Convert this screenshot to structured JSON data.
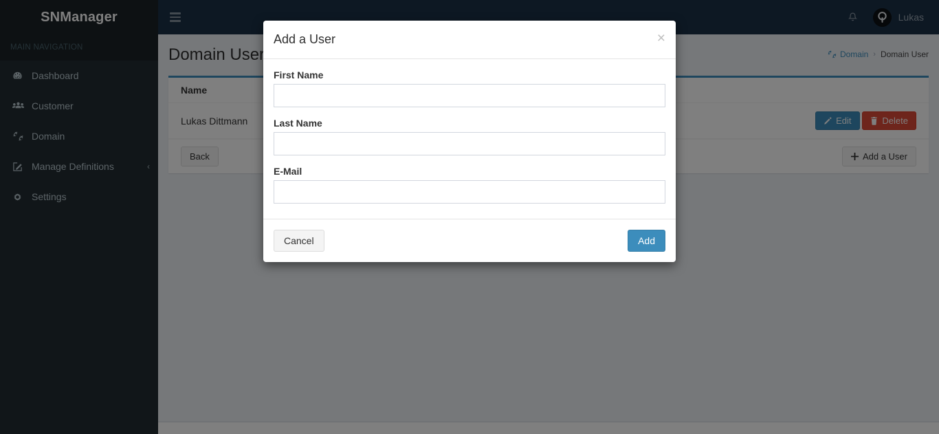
{
  "brand": {
    "title": "SNManager"
  },
  "sidebar": {
    "header": "MAIN NAVIGATION",
    "items": [
      {
        "label": "Dashboard",
        "icon": "dashboard-icon"
      },
      {
        "label": "Customer",
        "icon": "users-icon"
      },
      {
        "label": "Domain",
        "icon": "gears-icon"
      },
      {
        "label": "Manage Definitions",
        "icon": "edit-square-icon",
        "arrow": "‹"
      },
      {
        "label": "Settings",
        "icon": "gear-icon"
      }
    ]
  },
  "navbar": {
    "toggle": "sidebar-toggle-icon",
    "bell": "bell-icon",
    "user_name": "Lukas"
  },
  "content_header": {
    "title": "Domain User",
    "breadcrumb": {
      "root_icon": "gears-icon",
      "root": "Domain",
      "separator": "›",
      "current": "Domain User"
    }
  },
  "table": {
    "columns": [
      "Name"
    ],
    "rows": [
      {
        "name": "Lukas Dittmann",
        "edit_label": "Edit",
        "delete_label": "Delete"
      }
    ]
  },
  "footer_actions": {
    "back_label": "Back",
    "add_user_label": "Add a User",
    "add_user_icon": "plus-icon"
  },
  "modal": {
    "title": "Add a User",
    "close_label": "×",
    "fields": [
      {
        "label": "First Name",
        "value": "",
        "placeholder": ""
      },
      {
        "label": "Last Name",
        "value": "",
        "placeholder": ""
      },
      {
        "label": "E-Mail",
        "value": "",
        "placeholder": ""
      }
    ],
    "cancel_label": "Cancel",
    "submit_label": "Add"
  },
  "colors": {
    "sidebar_bg": "#222d32",
    "navbar_bg": "#1b3047",
    "primary": "#3c8dbc",
    "danger": "#dd4b39",
    "content_bg": "#ecf0f5",
    "box_border_top": "#3c8dbc"
  }
}
